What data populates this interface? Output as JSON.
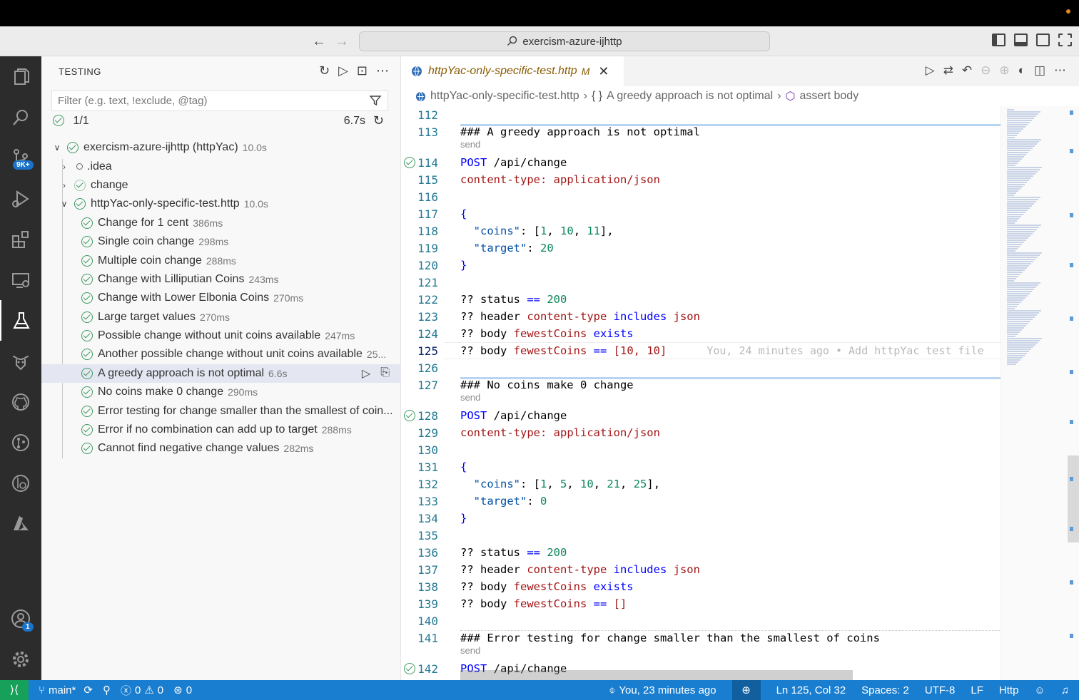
{
  "window": {
    "search_text": "exercism-azure-ijhttp"
  },
  "activity_bar": {
    "scm_badge": "9K+",
    "accounts_badge": "1"
  },
  "sidebar": {
    "title": "TESTING",
    "filter_placeholder": "Filter (e.g. text, !exclude, @tag)",
    "summary_count": "1/1",
    "summary_duration": "6.7s",
    "root": {
      "label": "exercism-azure-ijhttp (httpYac)",
      "duration": "10.0s"
    },
    "folder_idea": ".idea",
    "folder_change": "change",
    "file": {
      "label": "httpYac-only-specific-test.http",
      "duration": "10.0s"
    },
    "tests": [
      {
        "label": "Change for 1 cent",
        "duration": "386ms"
      },
      {
        "label": "Single coin change",
        "duration": "298ms"
      },
      {
        "label": "Multiple coin change",
        "duration": "288ms"
      },
      {
        "label": "Change with Lilliputian Coins",
        "duration": "243ms"
      },
      {
        "label": "Change with Lower Elbonia Coins",
        "duration": "270ms"
      },
      {
        "label": "Large target values",
        "duration": "270ms"
      },
      {
        "label": "Possible change without unit coins available",
        "duration": "247ms"
      },
      {
        "label": "Another possible change without unit coins available",
        "duration": "25..."
      },
      {
        "label": "A greedy approach is not optimal",
        "duration": "6.6s"
      },
      {
        "label": "No coins make 0 change",
        "duration": "290ms"
      },
      {
        "label": "Error testing for change smaller than the smallest of coin...",
        "duration": ""
      },
      {
        "label": "Error if no combination can add up to target",
        "duration": "288ms"
      },
      {
        "label": "Cannot find negative change values",
        "duration": "282ms"
      }
    ]
  },
  "editor": {
    "tab_name": "httpYac-only-specific-test.http",
    "tab_modified": "M",
    "breadcrumb": [
      "httpYac-only-specific-test.http",
      "A greedy approach is not optimal",
      "assert body"
    ],
    "breadcrumb_braces": "{ }",
    "code_lens": "send",
    "line_numbers": [
      "112",
      "113",
      "114",
      "115",
      "116",
      "117",
      "118",
      "119",
      "120",
      "121",
      "122",
      "123",
      "124",
      "125",
      "126",
      "127",
      "128",
      "129",
      "130",
      "131",
      "132",
      "133",
      "134",
      "135",
      "136",
      "137",
      "138",
      "139",
      "140",
      "141",
      "142"
    ],
    "code": {
      "l113": "### A greedy approach is not optimal",
      "l114_method": "POST",
      "l114_path": " /api/change",
      "l115_key": "content-type:",
      "l115_val": " application/json",
      "brace_open": "{",
      "brace_close": "}",
      "l118_key": "\"coins\"",
      "l118_rest_a": ": [",
      "l118_n1": "1",
      "l118_n2": "10",
      "l118_n3": "11",
      "l119_key": "\"target\"",
      "l119_val": "20",
      "status_kw": "?? status ",
      "status_op": "==",
      "status_val": " 200",
      "header_kw": "?? header ",
      "header_name": "content-type",
      "includes": " includes ",
      "json": "json",
      "body_kw": "?? body ",
      "fewest": "fewestCoins",
      "exists": " exists",
      "l125_tail": " [10, 10]",
      "blame": "You, 24 minutes ago • Add httpYac test file",
      "l127": "### No coins make 0 change",
      "l132_nums": [
        "1",
        "5",
        "10",
        "21",
        "25"
      ],
      "l133_val": "0",
      "l139_tail": " []",
      "l141": "### Error testing for change smaller than the smallest of coins"
    }
  },
  "statusbar": {
    "branch": "main*",
    "errors": "0",
    "warnings": "0",
    "ports": "0",
    "blame": "You, 23 minutes ago",
    "position": "Ln 125, Col 32",
    "spaces": "Spaces: 2",
    "encoding": "UTF-8",
    "eol": "LF",
    "language": "Http"
  },
  "colors": {
    "accent": "#1a7ed0",
    "remote": "#17a05a",
    "pass": "#3c9a5f",
    "activity_bg": "#2c2c2c"
  }
}
